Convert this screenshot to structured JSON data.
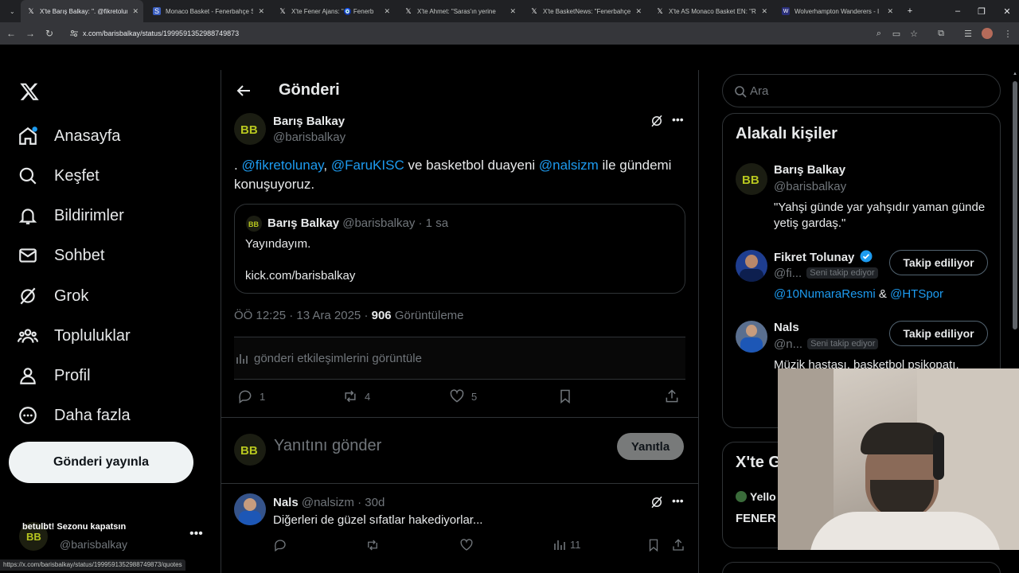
{
  "browser": {
    "tabs": [
      {
        "title": "X'te Barış Balkay: \". @fikretolunay",
        "active": true,
        "favicon": "x-logo-icon"
      },
      {
        "title": "Monaco Basket - Fenerbahçe S",
        "active": false,
        "favicon": "site-icon"
      },
      {
        "title": "X'te Fener Ajans: \"🧿 Fenerb",
        "active": false,
        "favicon": "x-logo-icon"
      },
      {
        "title": "X'te Ahmet: \"Saras'ın yerine",
        "active": false,
        "favicon": "x-logo-icon"
      },
      {
        "title": "X'te BasketNews: \"Fenerbahçe",
        "active": false,
        "favicon": "x-logo-icon"
      },
      {
        "title": "X'te AS Monaco Basket EN: \"RE",
        "active": false,
        "favicon": "x-logo-icon"
      },
      {
        "title": "Wolverhampton Wanderers - I",
        "active": false,
        "favicon": "site-icon"
      }
    ],
    "url": "x.com/barisbalkay/status/1999591352988749873",
    "status_url": "https://x.com/barisbalkay/status/1999591352988749873/quotes"
  },
  "sidebar": {
    "items": [
      {
        "label": "Anasayfa",
        "icon": "home-icon"
      },
      {
        "label": "Keşfet",
        "icon": "search-icon"
      },
      {
        "label": "Bildirimler",
        "icon": "bell-icon"
      },
      {
        "label": "Sohbet",
        "icon": "mail-icon"
      },
      {
        "label": "Grok",
        "icon": "grok-icon"
      },
      {
        "label": "Topluluklar",
        "icon": "communities-icon"
      },
      {
        "label": "Profil",
        "icon": "person-icon"
      },
      {
        "label": "Daha fazla",
        "icon": "more-circle-icon"
      }
    ],
    "post_button": "Gönderi yayınla",
    "account": {
      "overlay_name": "betulbt! Sezonu kapatsın",
      "handle": "@barisbalkay"
    }
  },
  "main": {
    "header_title": "Gönderi",
    "tweet": {
      "author_name": "Barış Balkay",
      "author_handle": "@barisbalkay",
      "text_prefix": ". ",
      "mention1": "@fikretolunay",
      "comma": ", ",
      "mention2": "@FaruKISC",
      "text_mid": " ve basketbol duayeni ",
      "mention3": "@nalsizm",
      "text_suffix": " ile gündemi konuşuyoruz.",
      "quote": {
        "author_name": "Barış Balkay",
        "author_handle": "@barisbalkay",
        "time": "· 1 sa",
        "line1": "Yayındayım.",
        "line2": "kick.com/barisbalkay"
      },
      "timestamp": "ÖÖ 12:25 · 13 Ara 2025 · ",
      "views_count": "906",
      "views_label": "Görüntüleme",
      "engagement_link": "gönderi etkileşimlerini görüntüle",
      "replies": "1",
      "reposts": "4",
      "likes": "5"
    },
    "reply_placeholder": "Yanıtını gönder",
    "reply_button": "Yanıtla",
    "comment": {
      "author_name": "Nals",
      "author_handle": "@nalsizm",
      "time": "· 30d",
      "text": "Diğerleri de güzel sıfatlar hakediyorlar...",
      "views": "11"
    }
  },
  "right": {
    "search_placeholder": "Ara",
    "related_title": "Alakalı kişiler",
    "people": [
      {
        "name": "Barış Balkay",
        "handle": "@barisbalkay",
        "bio": "\"Yahşi günde yar yahşıdır yaman günde yetiş gardaş.\""
      },
      {
        "name": "Fikret Tolunay",
        "handle": "@fi...",
        "follows_you": "Seni takip ediyor",
        "button": "Takip ediliyor",
        "bio_link1": "@10NumaraResmi",
        "bio_amp": " & ",
        "bio_link2": "@HTSpor",
        "verified": true
      },
      {
        "name": "Nals",
        "handle": "@n...",
        "follows_you": "Seni takip ediyor",
        "button": "Takip ediliyor",
        "bio": "Müzik hastası, basketbol psikopatı,"
      }
    ],
    "trends_title": "X'te G",
    "trend_item1": "Yello",
    "trend_item2": "FENER"
  },
  "colors": {
    "accent": "#1d9bf0",
    "background": "#000000",
    "border": "#2f3336",
    "muted": "#71767b"
  }
}
